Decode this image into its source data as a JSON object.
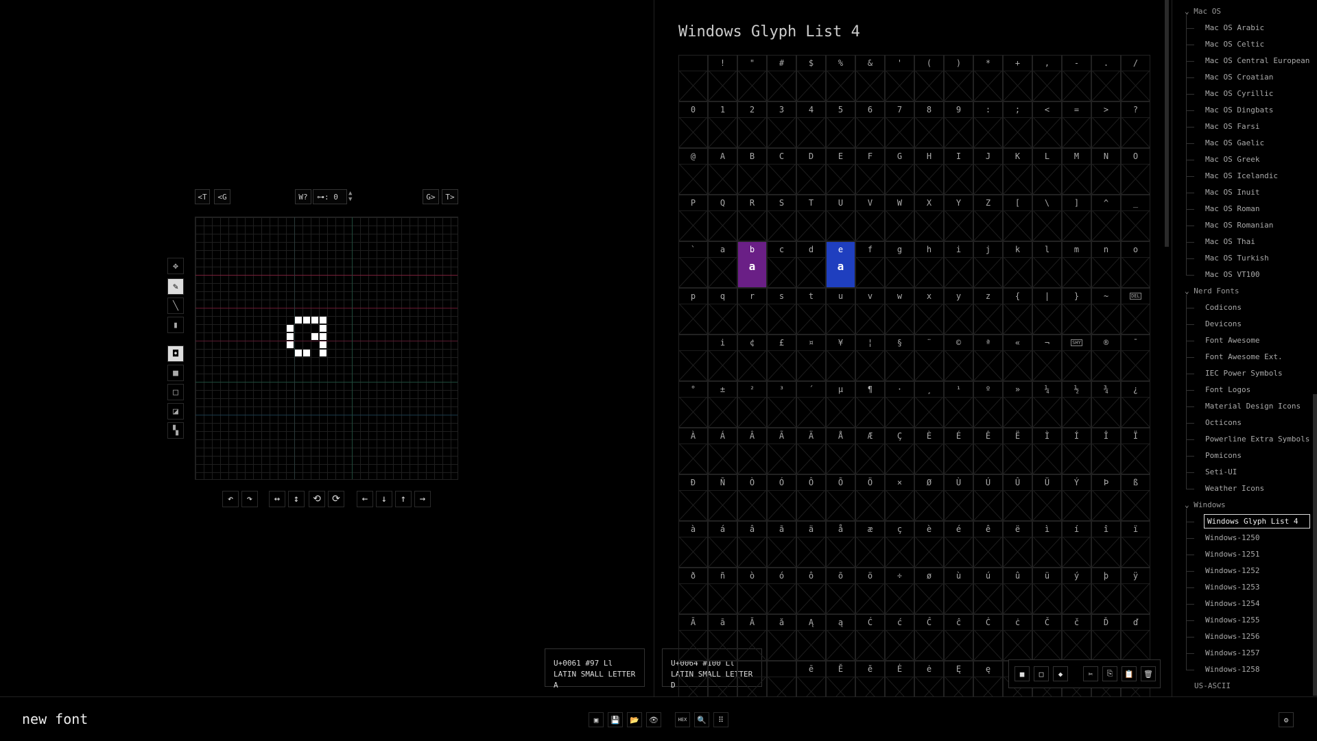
{
  "app": {
    "font_name": "new font"
  },
  "editor": {
    "nav": {
      "prev_table": "<T",
      "prev_glyph": "<G",
      "width_q": "W?",
      "offset": "⊶: 0",
      "next_glyph": "G>",
      "next_table": "T>"
    },
    "tools": [
      {
        "name": "move-tool",
        "icon": "✥",
        "selected": false
      },
      {
        "name": "pencil-tool",
        "icon": "✎",
        "selected": true
      },
      {
        "name": "line-tool",
        "icon": "╲",
        "selected": false
      },
      {
        "name": "rect-tool",
        "icon": "▮",
        "selected": false
      }
    ],
    "fill_modes": [
      {
        "name": "frame-mode",
        "icon": "◘",
        "selected": true
      },
      {
        "name": "solid-mode",
        "icon": "■",
        "selected": false
      },
      {
        "name": "outline-mode",
        "icon": "□",
        "selected": false
      },
      {
        "name": "invert-mode",
        "icon": "◪",
        "selected": false
      },
      {
        "name": "checker-mode",
        "icon": "▚",
        "selected": false
      }
    ],
    "actions": [
      {
        "name": "undo",
        "icon": "↶"
      },
      {
        "name": "redo",
        "icon": "↷"
      },
      {
        "name": "flip-horizontal",
        "icon": "↔"
      },
      {
        "name": "flip-vertical",
        "icon": "↕"
      },
      {
        "name": "rotate-left",
        "icon": "⟲"
      },
      {
        "name": "rotate-right",
        "icon": "⟳"
      },
      {
        "name": "shift-left",
        "icon": "←"
      },
      {
        "name": "shift-down",
        "icon": "↓"
      },
      {
        "name": "shift-up",
        "icon": "↑"
      },
      {
        "name": "shift-right",
        "icon": "→"
      }
    ],
    "glyph_pixels": [
      [
        12,
        12
      ],
      [
        13,
        12
      ],
      [
        14,
        12
      ],
      [
        15,
        12
      ],
      [
        11,
        13
      ],
      [
        15,
        13
      ],
      [
        11,
        14
      ],
      [
        14,
        14
      ],
      [
        15,
        14
      ],
      [
        11,
        15
      ],
      [
        15,
        15
      ],
      [
        12,
        16
      ],
      [
        13,
        16
      ],
      [
        15,
        16
      ]
    ]
  },
  "info_a": {
    "line1": "U+0061  #97  Ll",
    "line2": "LATIN SMALL LETTER A"
  },
  "info_d": {
    "line1": "U+0064  #100  Ll",
    "line2": "LATIN SMALL LETTER D"
  },
  "table": {
    "title": "Windows Glyph List 4",
    "rows": [
      [
        "",
        " ",
        "!",
        "\"",
        "#",
        "$",
        "%",
        "&",
        "'",
        "(",
        ")",
        "*",
        "+",
        ",",
        "-",
        "."
      ],
      [
        "",
        "0",
        "1",
        "2",
        "3",
        "4",
        "5",
        "6",
        "7",
        "8",
        "9",
        ":",
        ";",
        "<",
        "=",
        ">"
      ],
      [
        "",
        "@",
        "A",
        "B",
        "C",
        "D",
        "E",
        "F",
        "G",
        "H",
        "I",
        "J",
        "K",
        "L",
        "M",
        "N"
      ],
      [
        "",
        "P",
        "Q",
        "R",
        "S",
        "T",
        "U",
        "V",
        "W",
        "X",
        "Y",
        "Z",
        "[",
        "\\",
        "]",
        "^"
      ],
      [
        "",
        "`",
        "a",
        "b",
        "c",
        "d",
        "e",
        "f",
        "g",
        "h",
        "i",
        "j",
        "k",
        "l",
        "m",
        "n"
      ],
      [
        "",
        "p",
        "q",
        "r",
        "s",
        "t",
        "u",
        "v",
        "w",
        "x",
        "y",
        "z",
        "{",
        "|",
        "}",
        "~"
      ],
      [
        "",
        "",
        "i",
        "¢",
        "£",
        "¤",
        "¥",
        "¦",
        "§",
        "¨",
        "©",
        "ª",
        "«",
        "¬",
        "SHY",
        "®"
      ],
      [
        "",
        "°",
        "±",
        "²",
        "³",
        "´",
        "µ",
        "¶",
        "·",
        "¸",
        "¹",
        "º",
        "»",
        "¼",
        "½",
        "¾"
      ],
      [
        "",
        "À",
        "Á",
        "Â",
        "Ã",
        "Ä",
        "Å",
        "Æ",
        "Ç",
        "È",
        "É",
        "Ê",
        "Ë",
        "Ì",
        "Í",
        "Î"
      ],
      [
        "",
        "Ð",
        "Ñ",
        "Ò",
        "Ó",
        "Ô",
        "Õ",
        "Ö",
        "×",
        "Ø",
        "Ù",
        "Ú",
        "Û",
        "Ü",
        "Ý",
        "Þ"
      ],
      [
        "",
        "à",
        "á",
        "â",
        "ã",
        "ä",
        "å",
        "æ",
        "ç",
        "è",
        "é",
        "ê",
        "ë",
        "ì",
        "í",
        "î"
      ],
      [
        "",
        "ð",
        "ñ",
        "ò",
        "ó",
        "ô",
        "õ",
        "ö",
        "÷",
        "ø",
        "ù",
        "ú",
        "û",
        "ü",
        "ý",
        "þ"
      ],
      [
        "",
        "Ā",
        "ā",
        "Ă",
        "ă",
        "Ą",
        "ą",
        "Ć",
        "ć",
        "Ĉ",
        "ĉ",
        "Ċ",
        "ċ",
        "Č",
        "č",
        "Ď"
      ],
      [
        "",
        "",
        "",
        "",
        "",
        "ē",
        "Ĕ",
        "ĕ",
        "Ė",
        "ė",
        "Ę",
        "ę",
        "Ě",
        "",
        "",
        ""
      ]
    ],
    "last_col": [
      "/",
      "?",
      "O",
      "_",
      "o",
      "DEL",
      "¯",
      "¿",
      "Ï",
      "ß",
      "ï",
      "ÿ",
      "ď",
      ""
    ],
    "selected_a": {
      "row": 4,
      "col": 2,
      "glyph": "a"
    },
    "selected_d": {
      "row": 4,
      "col": 5,
      "glyph": "a"
    }
  },
  "sidebar": {
    "groups": [
      {
        "label": "Mac OS",
        "items": [
          "Mac OS Arabic",
          "Mac OS Celtic",
          "Mac OS Central European",
          "Mac OS Croatian",
          "Mac OS Cyrillic",
          "Mac OS Dingbats",
          "Mac OS Farsi",
          "Mac OS Gaelic",
          "Mac OS Greek",
          "Mac OS Icelandic",
          "Mac OS Inuit",
          "Mac OS Roman",
          "Mac OS Romanian",
          "Mac OS Thai",
          "Mac OS Turkish",
          "Mac OS VT100"
        ]
      },
      {
        "label": "Nerd Fonts",
        "items": [
          "Codicons",
          "Devicons",
          "Font Awesome",
          "Font Awesome Ext.",
          "IEC Power Symbols",
          "Font Logos",
          "Material Design Icons",
          "Octicons",
          "Powerline Extra Symbols",
          "Pomicons",
          "Seti-UI",
          "Weather Icons"
        ]
      },
      {
        "label": "Windows",
        "items": [
          "Windows Glyph List 4",
          "Windows-1250",
          "Windows-1251",
          "Windows-1252",
          "Windows-1253",
          "Windows-1254",
          "Windows-1255",
          "Windows-1256",
          "Windows-1257",
          "Windows-1258"
        ]
      }
    ],
    "after": "US-ASCII",
    "selected": "Windows Glyph List 4"
  },
  "bottom": {
    "buttons": [
      {
        "name": "new-font-button",
        "icon": "▣"
      },
      {
        "name": "save-button",
        "icon": "💾"
      },
      {
        "name": "open-button",
        "icon": "📂"
      },
      {
        "name": "preview-button",
        "icon": "👁"
      },
      {
        "name": "hex-button",
        "icon": "HEX"
      },
      {
        "name": "zoom-button",
        "icon": "🔍"
      },
      {
        "name": "grid-button",
        "icon": "⠿"
      }
    ],
    "settings_icon": "⚙"
  },
  "floatbar": [
    {
      "name": "fill-button",
      "icon": "■"
    },
    {
      "name": "clear-button",
      "icon": "□"
    },
    {
      "name": "invert-button",
      "icon": "◆"
    },
    {
      "name": "cut-button",
      "icon": "✂"
    },
    {
      "name": "copy-button",
      "icon": "⎘"
    },
    {
      "name": "paste-button",
      "icon": "📋"
    },
    {
      "name": "delete-button",
      "icon": "🗑"
    }
  ]
}
